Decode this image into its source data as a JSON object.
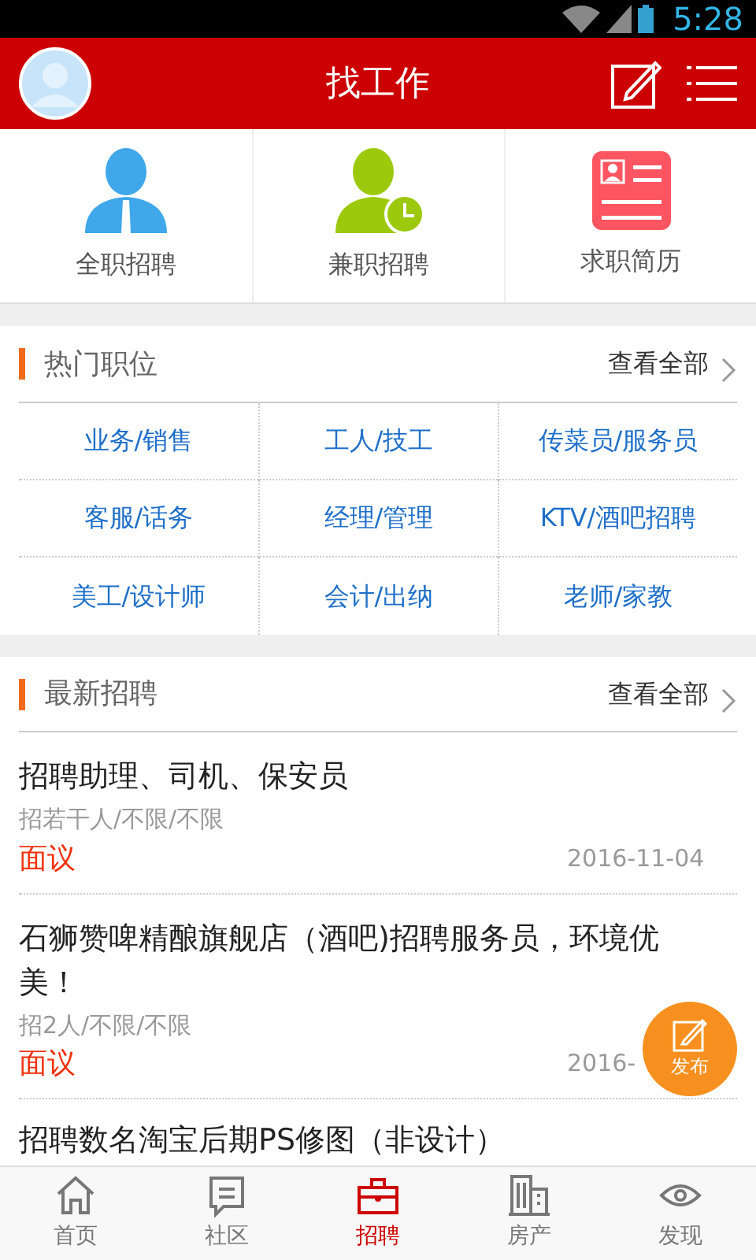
{
  "status_bar": {
    "time": "5:28"
  },
  "header": {
    "title": "找工作"
  },
  "quick_links": [
    {
      "label": "全职招聘",
      "kind": "fulltime"
    },
    {
      "label": "兼职招聘",
      "kind": "parttime"
    },
    {
      "label": "求职简历",
      "kind": "resume"
    }
  ],
  "hot_positions": {
    "title": "热门职位",
    "more": "查看全部",
    "items": [
      "业务/销售",
      "工人/技工",
      "传菜员/服务员",
      "客服/话务",
      "经理/管理",
      "KTV/酒吧招聘",
      "美工/设计师",
      "会计/出纳",
      "老师/家教"
    ]
  },
  "latest_jobs": {
    "title": "最新招聘",
    "more": "查看全部",
    "items": [
      {
        "title": "招聘助理、司机、保安员",
        "details": "招若干人/不限/不限",
        "salary": "面议",
        "date": "2016-11-04"
      },
      {
        "title": "石狮赞啤精酿旗舰店（酒吧)招聘服务员，环境优美！",
        "details": "招2人/不限/不限",
        "salary": "面议",
        "date": "2016-"
      },
      {
        "title": "招聘数名淘宝后期PS修图（非设计）"
      }
    ]
  },
  "fab": {
    "label": "发布"
  },
  "tab_bar": [
    {
      "label": "首页",
      "kind": "home",
      "selected": false
    },
    {
      "label": "社区",
      "kind": "community",
      "selected": false
    },
    {
      "label": "招聘",
      "kind": "jobs",
      "selected": true
    },
    {
      "label": "房产",
      "kind": "property",
      "selected": false
    },
    {
      "label": "发现",
      "kind": "discover",
      "selected": false
    }
  ]
}
